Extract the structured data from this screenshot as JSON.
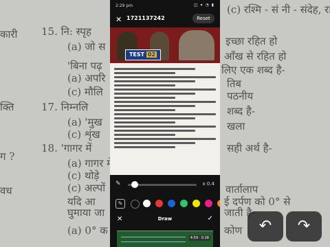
{
  "status_bar": {
    "time": "2:29 pm",
    "icons": "◫ ▾ ◔ ▮"
  },
  "app": {
    "file_id": "1721137242",
    "close_glyph": "✕",
    "reset_label": "Reset"
  },
  "document": {
    "banner_badge_text": "TEST",
    "banner_badge_number": "02"
  },
  "canvas_controls": {
    "undo_glyph": "↶",
    "redo_glyph": "↷"
  },
  "brush": {
    "pen_glyph": "✎",
    "size_label": "x 0.4",
    "size_value": 0.1
  },
  "palette": {
    "tool_glyph": "✎",
    "colors": [
      "#111111",
      "#ffffff",
      "#e53935",
      "#1e63d6",
      "#34c26b",
      "#f2e400",
      "#e91e8c",
      "#f08a16"
    ]
  },
  "bottom_bar": {
    "cancel_glyph": "✕",
    "title": "Draw",
    "confirm_glyph": "✓"
  },
  "timeline": {
    "tag": "4:59 · 0:28"
  },
  "background_text": {
    "top_right": "(c) रश्मि - सं नी - संदेह, रहस्य",
    "l1": "15. नि: स्पृह",
    "l1b": "इच्छा रहित हो",
    "l2": "(a) जो स",
    "l2b": "आँख से रहित हो",
    "l3": "'बिना पढ़",
    "l3b": "लिए एक शब्द है-",
    "l4": "(a) अपरि",
    "l4b": "तिब",
    "l5": "(c) मौलि",
    "l5b": "पठनीय",
    "l6": "17. निम्नलि",
    "l6b": "शब्द है-",
    "l7": "(a) 'मुख",
    "l7b": "खला",
    "l8": "(c) शृंख",
    "l8b": "खला",
    "l9": "18. 'गागर में",
    "l9b": "सही अर्थ है-",
    "l10": "(a) गागर में",
    "l11": "(c) थोड़े",
    "l12": "(c) अल्पों",
    "l12b": "वार्तालाप",
    "l13": "यदि आ",
    "l13b": "ई दर्पण को 0° से",
    "l14": "घुमाया जा",
    "l14b": "जाती है-",
    "l15": "(a) 0° क",
    "l15b": "कोण",
    "left1": "कारी",
    "left2": "क्ति",
    "left3": "ग ?",
    "left4": "वध"
  },
  "large_controls": {
    "undo_glyph": "↶",
    "redo_glyph": "↷"
  }
}
